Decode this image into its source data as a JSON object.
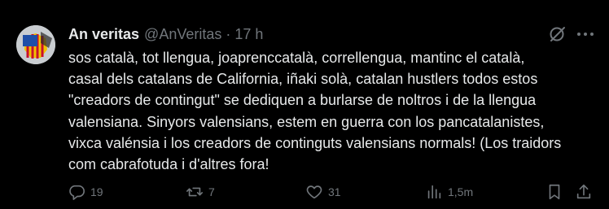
{
  "tweet": {
    "display_name": "An veritas",
    "handle": "@AnVeritas",
    "separator": "·",
    "time": "17 h",
    "text": "sos català, tot llengua, joaprenccatalà, correllengua, mantinc el català,\ncasal dels catalans de California, iñaki solà, catalan hustlers todos estos\n\"creadors de contingut\" se dediquen a burlarse de noltros i de la llengua\nvalensiana. Sinyors valensians, estem en guerra con los pancatalanistes,\nvixca valénsia i los creadors de continguts valensians normals! (Los traidors\ncom cabrafotuda i d'altres fora!"
  },
  "actions": {
    "replies": "19",
    "reposts": "7",
    "likes": "31",
    "views": "1,5m"
  },
  "icons": {
    "grok": "grok-icon",
    "more": "more-icon",
    "reply": "reply-icon",
    "repost": "repost-icon",
    "like": "heart-icon",
    "views": "views-icon",
    "bookmark": "bookmark-icon",
    "share": "share-icon"
  },
  "colors": {
    "background": "#000000",
    "text": "#e7e9ea",
    "muted": "#71767b",
    "avatar_blue": "#1f4fa8",
    "avatar_red": "#c8102e",
    "avatar_yellow": "#f2c200"
  }
}
